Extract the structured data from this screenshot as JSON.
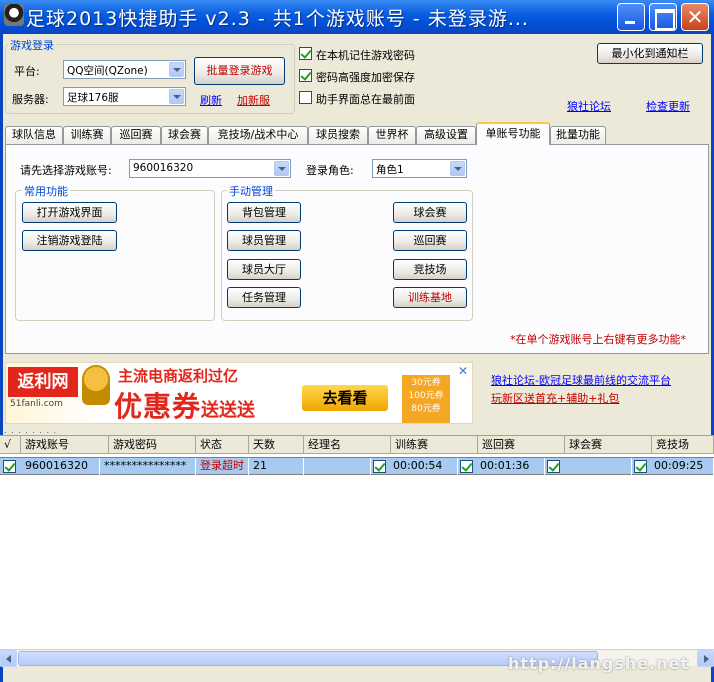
{
  "window": {
    "title": "足球2013快捷助手 v2.3  - 共1个游戏账号 - 未登录游..."
  },
  "login": {
    "legend": "游戏登录",
    "platform_label": "平台:",
    "platform_value": "QQ空间(QZone)",
    "server_label": "服务器:",
    "server_value": "足球176服",
    "batch_login_button": "批量登录游戏",
    "refresh_link": "刷新",
    "add_server_link": "加新服"
  },
  "options": {
    "remember_password": "在本机记住游戏密码",
    "strong_encrypt": "密码高强度加密保存",
    "always_on_top": "助手界面总在最前面",
    "remember_password_checked": true,
    "strong_encrypt_checked": true,
    "always_on_top_checked": false
  },
  "top_right": {
    "minimize_tray_button": "最小化到通知栏",
    "forum_link": "狼社论坛",
    "check_update_link": "检查更新"
  },
  "tabs": [
    "球队信息",
    "训练赛",
    "巡回赛",
    "球会赛",
    "竞技场/战术中心",
    "球员搜索",
    "世界杯",
    "高级设置",
    "单账号功能",
    "批量功能"
  ],
  "active_tab": "单账号功能",
  "single": {
    "account_label": "请先选择游戏账号:",
    "account_value": "960016320",
    "role_label": "登录角色:",
    "role_value": "角色1",
    "common_legend": "常用功能",
    "open_game_button": "打开游戏界面",
    "logout_button": "注销游戏登陆",
    "manual_legend": "手动管理",
    "backpack_button": "背包管理",
    "player_manage_button": "球员管理",
    "player_hall_button": "球员大厅",
    "task_button": "任务管理",
    "club_match_button": "球会赛",
    "tour_button": "巡回赛",
    "arena_button": "竞技场",
    "training_base_button": "训练基地",
    "hint": "*在单个游戏账号上右键有更多功能*"
  },
  "banner": {
    "logo_text": "返利网",
    "logo_sub": "51fanli.com",
    "headline": "主流电商返利过亿",
    "big_text": "优惠券",
    "big_suffix": "送送送",
    "cta": "去看看",
    "coupon_text": "30元券 100元券 80元券",
    "close_icon": "✕"
  },
  "side_links": {
    "line1": "狼社论坛-欧冠足球最前线的交流平台",
    "line2": "玩新区送首充+辅助+礼包"
  },
  "grid": {
    "dots": ". . . . . . . .",
    "headers": [
      "√",
      "游戏账号",
      "游戏密码",
      "状态",
      "天数",
      "经理名",
      "训练赛",
      "巡回赛",
      "球会赛",
      "竞技场"
    ],
    "rows": [
      {
        "account": "960016320",
        "password": "***************",
        "status": "登录超时",
        "days": "21",
        "manager": "",
        "training": "00:00:54",
        "tour": "00:01:36",
        "club": "",
        "arena": "00:09:25"
      }
    ]
  },
  "watermark": "http://langshe.net"
}
